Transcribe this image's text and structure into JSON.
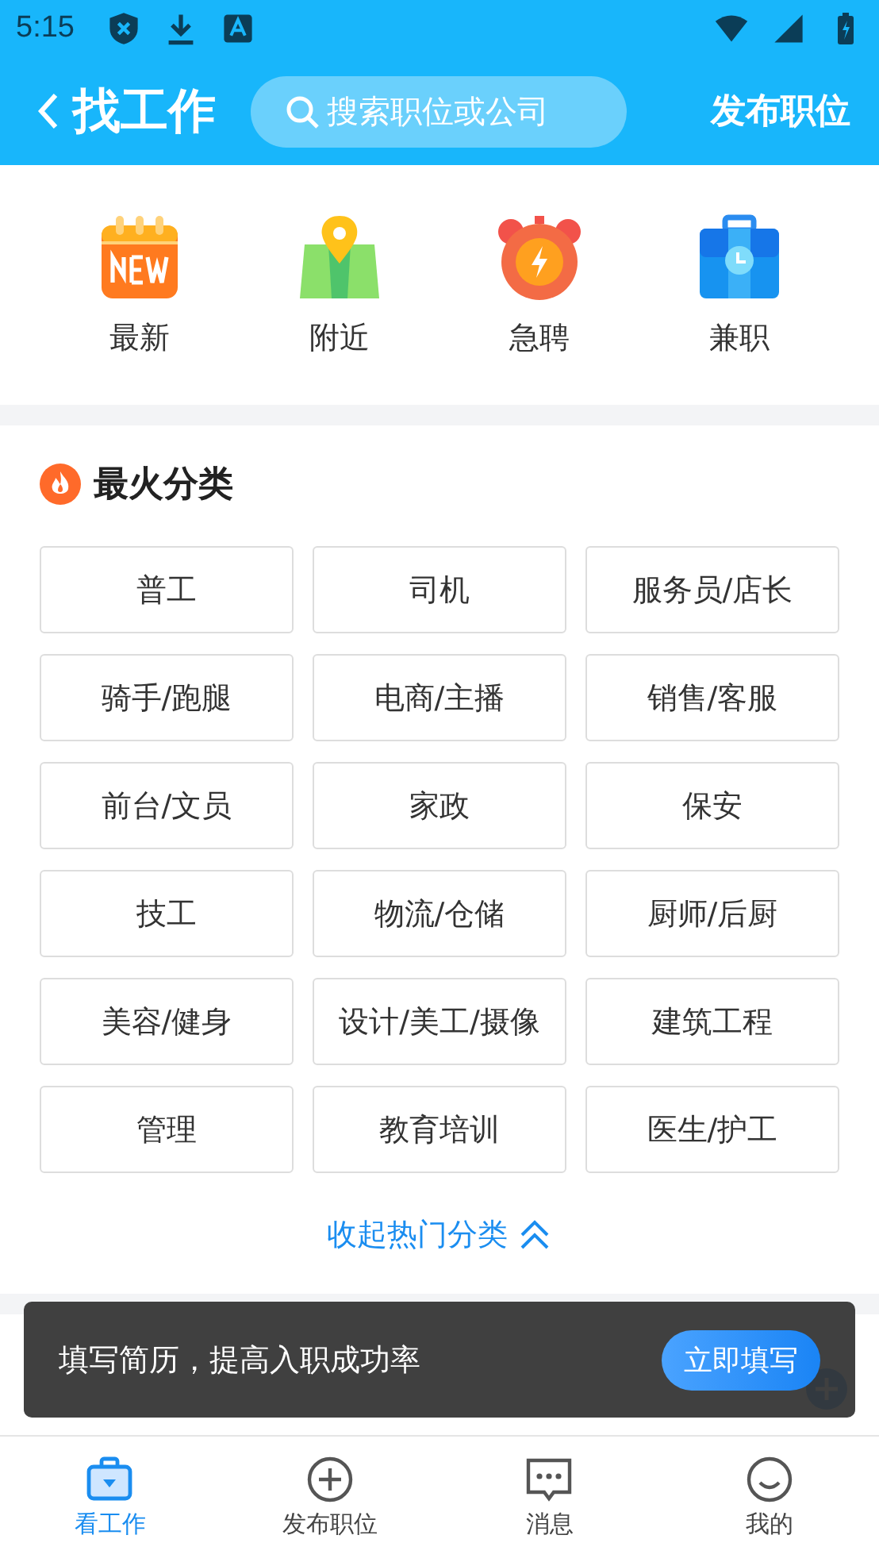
{
  "status_bar": {
    "time": "5:15"
  },
  "header": {
    "title": "找工作",
    "search": {
      "placeholder": "搜索职位或公司"
    },
    "action": "发布职位"
  },
  "quick_links": [
    {
      "label": "最新",
      "kind": "calendar"
    },
    {
      "label": "附近",
      "kind": "map"
    },
    {
      "label": "急聘",
      "kind": "alarm"
    },
    {
      "label": "兼职",
      "kind": "briefcase"
    }
  ],
  "hot_categories": {
    "title": "最火分类",
    "items": [
      "普工",
      "司机",
      "服务员/店长",
      "骑手/跑腿",
      "电商/主播",
      "销售/客服",
      "前台/文员",
      "家政",
      "保安",
      "技工",
      "物流/仓储",
      "厨师/后厨",
      "美容/健身",
      "设计/美工/摄像",
      "建筑工程",
      "管理",
      "教育培训",
      "医生/护工"
    ],
    "collapse": "收起热门分类"
  },
  "toast": {
    "message": "填写简历，提高入职成功率",
    "button": "立即填写"
  },
  "bottom_nav": [
    {
      "label": "看工作",
      "kind": "briefcase",
      "selected": true
    },
    {
      "label": "发布职位",
      "kind": "plus",
      "selected": false
    },
    {
      "label": "消息",
      "kind": "message",
      "selected": false
    },
    {
      "label": "我的",
      "kind": "profile",
      "selected": false
    }
  ]
}
